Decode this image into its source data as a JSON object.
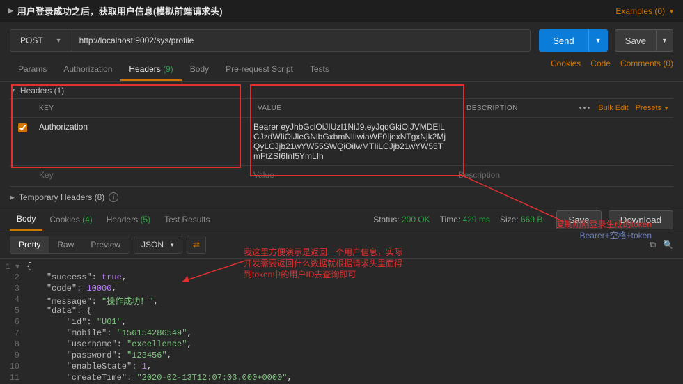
{
  "title": "用户登录成功之后，获取用户信息(模拟前端请求头)",
  "examples": {
    "label": "Examples (0)"
  },
  "method": "POST",
  "url": "http://localhost:9002/sys/profile",
  "send": "Send",
  "save": "Save",
  "tabs": {
    "params": "Params",
    "authorization": "Authorization",
    "headers": "Headers",
    "headers_count": "(9)",
    "body": "Body",
    "prerequest": "Pre-request Script",
    "tests": "Tests"
  },
  "right_links": {
    "cookies": "Cookies",
    "code": "Code",
    "comments": "Comments (0)"
  },
  "headers_section": "Headers (1)",
  "temp_headers_section": "Temporary Headers (8)",
  "th": {
    "key": "KEY",
    "value": "VALUE",
    "desc": "DESCRIPTION"
  },
  "th_actions": {
    "bulk": "Bulk Edit",
    "presets": "Presets"
  },
  "row1": {
    "key": "Authorization",
    "value": "Bearer eyJhbGciOiJIUzI1NiJ9.eyJqdGkiOiJVMDEiLCJzdWIiOiJleGNlbGxbmNlIiwiaWF0IjoxNTgxNjk2MjQyLCJjb21wYW55SWQiOiIwMTIiLCJjb21wYW55TmFtZSI6InI5YmLIh"
  },
  "row_placeholder": {
    "key": "Key",
    "value": "Value",
    "desc": "Description"
  },
  "response": {
    "tabs": {
      "body": "Body",
      "cookies": "Cookies",
      "cookies_count": "(4)",
      "headers": "Headers",
      "headers_count": "(5)",
      "tests": "Test Results"
    },
    "status_label": "Status:",
    "status_value": "200 OK",
    "time_label": "Time:",
    "time_value": "429 ms",
    "size_label": "Size:",
    "size_value": "669 B",
    "save": "Save",
    "download": "Download",
    "view": {
      "pretty": "Pretty",
      "raw": "Raw",
      "preview": "Preview",
      "json": "JSON"
    }
  },
  "json_body": {
    "success": true,
    "code": 10000,
    "message": "操作成功！",
    "data": {
      "id": "U01",
      "mobile": "156154286549",
      "username": "excellence",
      "password": "123456",
      "enableState": 1,
      "createTime": "2020-02-13T12:07:03.000+0000"
    }
  },
  "annotations": {
    "a": "复制刚刚登录生成的token",
    "a2": "Bearer+空格+token",
    "b": "我这里方便演示是返回一个用户信息，实际开发需要返回什么数据就根据请求头里面得到token中的用户ID去查询即可"
  }
}
